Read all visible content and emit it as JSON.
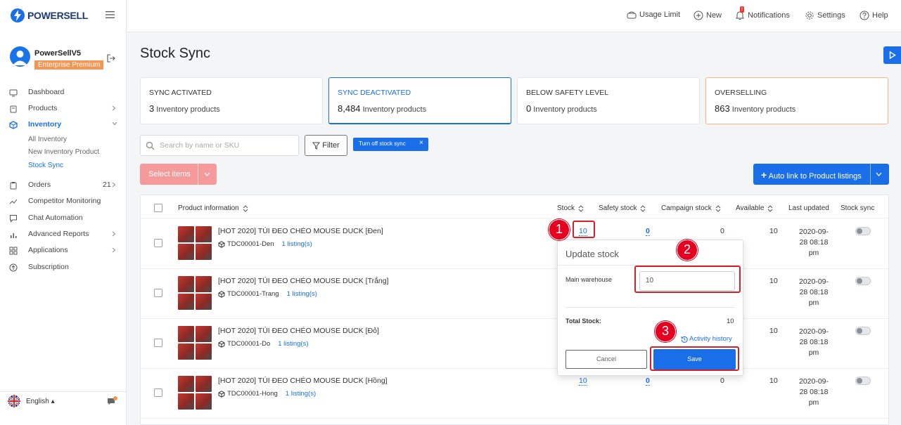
{
  "app": {
    "name": "POWERSELL"
  },
  "user": {
    "name": "PowerSellV5",
    "plan": "Enterprise Premium"
  },
  "sidebar": {
    "items": [
      {
        "label": "Dashboard"
      },
      {
        "label": "Products"
      },
      {
        "label": "Inventory"
      },
      {
        "label": "Orders",
        "count": "21"
      },
      {
        "label": "Competitor Monitoring"
      },
      {
        "label": "Chat Automation"
      },
      {
        "label": "Advanced Reports"
      },
      {
        "label": "Applications"
      },
      {
        "label": "Subscription"
      }
    ],
    "inventory_sub": [
      "All Inventory",
      "New Inventory Product",
      "Stock Sync"
    ],
    "language": "English"
  },
  "header": {
    "usage_limit": "Usage Limit",
    "new": "New",
    "notifications": "Notifications",
    "notification_count": "!",
    "settings": "Settings",
    "help": "Help"
  },
  "page": {
    "title": "Stock Sync"
  },
  "cards": [
    {
      "title": "SYNC ACTIVATED",
      "count": "3",
      "unit": "Inventory products"
    },
    {
      "title": "SYNC DEACTIVATED",
      "count": "8,484",
      "unit": "Inventory products"
    },
    {
      "title": "BELOW SAFETY LEVEL",
      "count": "0",
      "unit": "Inventory products"
    },
    {
      "title": "OVERSELLING",
      "count": "863",
      "unit": "Inventory products"
    }
  ],
  "toolbar": {
    "search_placeholder": "Search by name or SKU",
    "filter_label": "Filter",
    "active_tag": "Turn off stock sync",
    "select_items": "Select items",
    "auto_link": "Auto link to Product listings"
  },
  "table": {
    "headers": [
      "Product information",
      "Stock",
      "Safety stock",
      "Campaign stock",
      "Available",
      "Last updated",
      "Stock sync"
    ],
    "rows": [
      {
        "name": "[HOT 2020] TÚI ĐEO CHÉO MOUSE DUCK [Đen]",
        "sku": "TDC00001-Den",
        "listings": "1 listing(s)",
        "stock": "10",
        "safety": "0",
        "campaign": "0",
        "available": "10",
        "updated": "2020-09-28 08:18 pm"
      },
      {
        "name": "[HOT 2020] TÚI ĐEO CHÉO MOUSE DUCK [Trắng]",
        "sku": "TDC00001-Trang",
        "listings": "1 listing(s)",
        "stock": "",
        "safety": "",
        "campaign": "",
        "available": "10",
        "updated": "2020-09-28 08:18 pm"
      },
      {
        "name": "[HOT 2020] TÚI ĐEO CHÉO MOUSE DUCK [Đỏ]",
        "sku": "TDC00001-Do",
        "listings": "1 listing(s)",
        "stock": "",
        "safety": "",
        "campaign": "",
        "available": "10",
        "updated": "2020-09-28 08:18 pm"
      },
      {
        "name": "[HOT 2020] TÚI ĐEO CHÉO MOUSE DUCK [Hồng]",
        "sku": "TDC00001-Hong",
        "listings": "1 listing(s)",
        "stock": "10",
        "safety": "0",
        "campaign": "0",
        "available": "10",
        "updated": "2020-09-28 08:18 pm"
      }
    ]
  },
  "popup": {
    "title": "Update stock",
    "warehouse_label": "Main warehouse",
    "warehouse_value": "10",
    "total_label": "Total Stock:",
    "total_value": "10",
    "history": "Activity history",
    "cancel": "Cancel",
    "save": "Save"
  },
  "annotations": [
    "1",
    "2",
    "3"
  ],
  "colors": {
    "primary": "#1a6fe8",
    "badge": "#f39654",
    "danger": "#e5001f",
    "select_disabled": "#f49a9a"
  }
}
